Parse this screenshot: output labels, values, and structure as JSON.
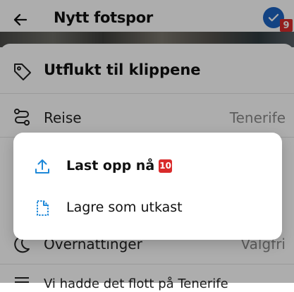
{
  "header": {
    "title": "Nytt fotspor",
    "back_icon": "arrow-left-icon",
    "confirm_icon": "check-icon",
    "badge": "9"
  },
  "form": {
    "name": "Utflukt til klippene",
    "travel_label": "Reise",
    "travel_value": "Tenerife",
    "nights_label": "Overnattinger",
    "nights_value": "Valgfri",
    "text_snippet": "Vi hadde det flott på Tenerife"
  },
  "dialog": {
    "upload_label": "Last opp nå",
    "upload_badge": "10",
    "draft_label": "Lagre som utkast"
  },
  "colors": {
    "accent": "#1c63c2",
    "badge": "#d92b2b",
    "dialog_icon": "#1e88d8"
  }
}
